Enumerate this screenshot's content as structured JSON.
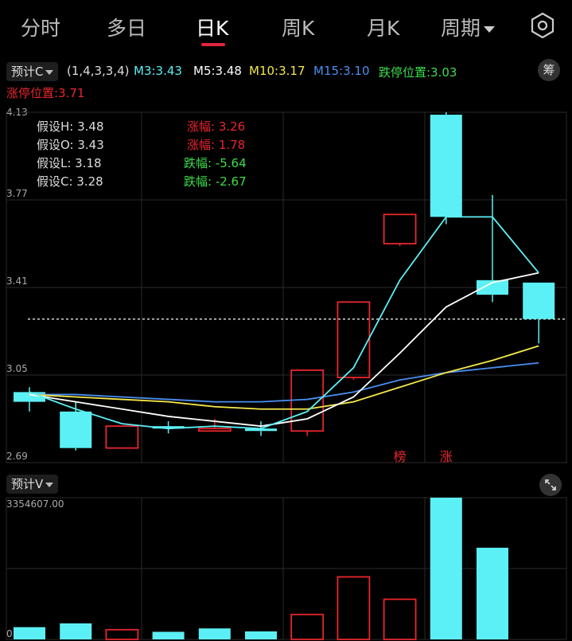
{
  "tabs": [
    "分时",
    "多日",
    "日K",
    "周K",
    "月K",
    "周期"
  ],
  "active_tab": "日K",
  "indicator": {
    "price_label": "预计C",
    "params": "(1,4,3,3,4)",
    "ma3": "M3:3.43",
    "ma5": "M5:3.48",
    "ma10": "M10:3.17",
    "ma15": "M15:3.10",
    "limit_down": "跌停位置:3.03",
    "limit_up": "涨停位置:3.71",
    "chou_button": "筹"
  },
  "assumptions": [
    {
      "label": "假设H: 3.48",
      "change": "涨幅: 3.26",
      "dir": "up"
    },
    {
      "label": "假设O: 3.43",
      "change": "涨幅: 1.78",
      "dir": "up"
    },
    {
      "label": "假设L: 3.18",
      "change": "跌幅: -5.64",
      "dir": "down"
    },
    {
      "label": "假设C: 3.28",
      "change": "跌幅: -2.67",
      "dir": "down"
    }
  ],
  "volume_label": "预计V",
  "colors": {
    "up": "#e8262e",
    "down": "#5bf0f5",
    "ma3": "#5bf0f5",
    "ma5": "#ffffff",
    "ma10": "#f5e84a",
    "ma15": "#4a8ef0",
    "grid": "#2a2a2a"
  },
  "chart_data": {
    "type": "candlestick",
    "y_ticks": [
      "4.13",
      "3.77",
      "3.41",
      "3.05",
      "2.69"
    ],
    "ylim": [
      2.69,
      4.13
    ],
    "ref_line": 3.28,
    "candles": [
      {
        "o": 2.98,
        "c": 2.94,
        "h": 3.0,
        "l": 2.9
      },
      {
        "o": 2.9,
        "c": 2.75,
        "h": 2.94,
        "l": 2.74
      },
      {
        "o": 2.75,
        "c": 2.84,
        "h": 2.84,
        "l": 2.75
      },
      {
        "o": 2.84,
        "c": 2.83,
        "h": 2.86,
        "l": 2.81
      },
      {
        "o": 2.82,
        "c": 2.83,
        "h": 2.87,
        "l": 2.82
      },
      {
        "o": 2.83,
        "c": 2.82,
        "h": 2.86,
        "l": 2.8
      },
      {
        "o": 2.82,
        "c": 3.07,
        "h": 3.07,
        "l": 2.8
      },
      {
        "o": 3.04,
        "c": 3.35,
        "h": 3.35,
        "l": 3.03
      },
      {
        "o": 3.59,
        "c": 3.71,
        "h": 3.71,
        "l": 3.58
      },
      {
        "o": 4.12,
        "c": 3.7,
        "h": 4.13,
        "l": 3.67
      },
      {
        "o": 3.44,
        "c": 3.38,
        "h": 3.79,
        "l": 3.35
      },
      {
        "o": 3.43,
        "c": 3.28,
        "h": 3.43,
        "l": 3.18
      }
    ],
    "ma3": [
      2.98,
      2.91,
      2.85,
      2.83,
      2.84,
      2.83,
      2.9,
      3.08,
      3.44,
      3.7,
      3.7,
      3.47
    ],
    "ma5": [
      2.97,
      2.94,
      2.91,
      2.88,
      2.86,
      2.84,
      2.87,
      2.96,
      3.14,
      3.33,
      3.43,
      3.47
    ],
    "ma10": [
      2.97,
      2.96,
      2.95,
      2.94,
      2.92,
      2.91,
      2.91,
      2.94,
      3.0,
      3.06,
      3.11,
      3.17
    ],
    "ma15": [
      2.97,
      2.97,
      2.96,
      2.95,
      2.94,
      2.94,
      2.95,
      2.98,
      3.03,
      3.06,
      3.08,
      3.1
    ],
    "markers": [
      {
        "index": 8,
        "text": "榜"
      },
      {
        "index": 9,
        "text": "涨"
      }
    ],
    "volume": {
      "y_ticks": [
        "3354607.00",
        "0.00"
      ],
      "ylim": [
        0,
        3354607
      ],
      "values": [
        290000,
        380000,
        230000,
        180000,
        260000,
        190000,
        590000,
        1480000,
        950000,
        3354607,
        2170000,
        0
      ],
      "dir": [
        "down",
        "down",
        "up",
        "down",
        "down",
        "down",
        "up",
        "up",
        "up",
        "down",
        "down",
        "down"
      ]
    }
  }
}
